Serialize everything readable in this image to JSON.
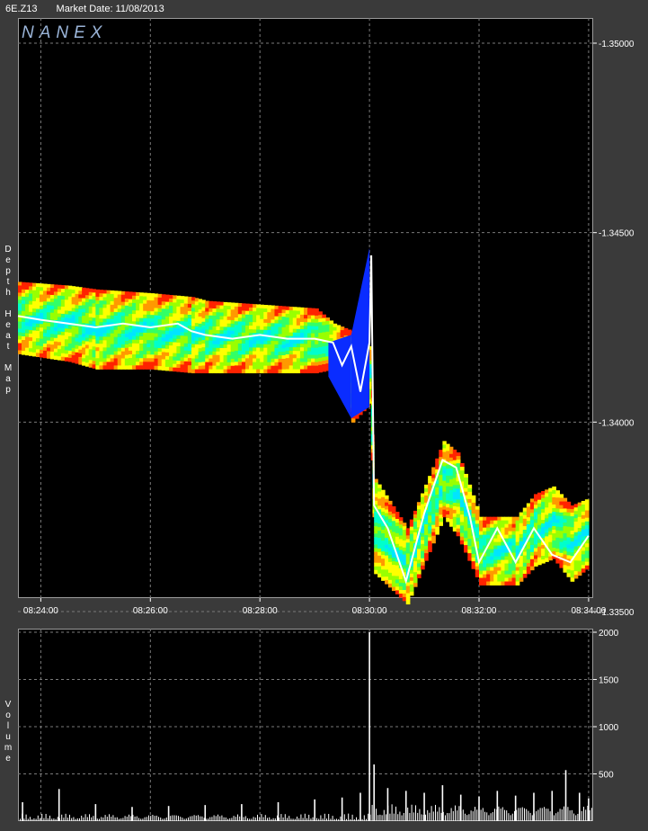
{
  "header": {
    "symbol": "6E.Z13",
    "market_date": "Market Date: 11/08/2013"
  },
  "logo": "NANEX",
  "colors": {
    "background": "#000000",
    "frame": "#3a3a3a",
    "grid": "#7a7a7a",
    "price_line": "#ffffff",
    "volume": "#ffffff"
  },
  "chart_data": [
    {
      "type": "heatmap",
      "title": "",
      "ylabel": "Depth Heat Map",
      "x_ticks": [
        "08:24:00",
        "08:26:00",
        "08:28:00",
        "08:30:00",
        "08:32:00",
        "08:34:00"
      ],
      "y_ticks": [
        "-1.35000",
        "-1.34500",
        "-1.34000",
        "-1.33500"
      ],
      "xlim": [
        "08:23:35",
        "08:34:05"
      ],
      "ylim": [
        1.335,
        1.35
      ],
      "grid": true,
      "price_series": {
        "name": "",
        "x": [
          "08:23:35",
          "08:24:00",
          "08:24:30",
          "08:25:00",
          "08:25:30",
          "08:26:00",
          "08:26:30",
          "08:26:45",
          "08:27:00",
          "08:27:30",
          "08:28:00",
          "08:28:30",
          "08:29:00",
          "08:29:20",
          "08:29:30",
          "08:29:40",
          "08:29:50",
          "08:30:00",
          "08:30:02",
          "08:30:05",
          "08:30:20",
          "08:30:40",
          "08:31:00",
          "08:31:20",
          "08:31:35",
          "08:31:50",
          "08:32:00",
          "08:32:20",
          "08:32:40",
          "08:33:00",
          "08:33:20",
          "08:33:40",
          "08:34:00"
        ],
        "y": [
          1.3428,
          1.3427,
          1.3426,
          1.3425,
          1.3426,
          1.3425,
          1.3426,
          1.3424,
          1.3423,
          1.3422,
          1.3423,
          1.3422,
          1.3422,
          1.3421,
          1.3415,
          1.342,
          1.3408,
          1.3421,
          1.3444,
          1.3378,
          1.3372,
          1.3358,
          1.3376,
          1.339,
          1.3388,
          1.3375,
          1.3363,
          1.3372,
          1.3363,
          1.3372,
          1.3365,
          1.3363,
          1.337
        ]
      },
      "depth_band": {
        "x": [
          "08:23:35",
          "08:24:30",
          "08:25:00",
          "08:26:00",
          "08:26:45",
          "08:27:00",
          "08:28:00",
          "08:29:00",
          "08:29:20",
          "08:29:40",
          "08:30:00",
          "08:30:05",
          "08:30:40",
          "08:31:20",
          "08:31:35",
          "08:32:00",
          "08:32:40",
          "08:33:00",
          "08:33:20",
          "08:33:40",
          "08:34:00"
        ],
        "top": [
          1.3437,
          1.3436,
          1.3435,
          1.3434,
          1.3433,
          1.3432,
          1.3431,
          1.343,
          1.3426,
          1.3424,
          1.342,
          1.3385,
          1.3372,
          1.3395,
          1.3392,
          1.3375,
          1.3375,
          1.3381,
          1.3383,
          1.3378,
          1.338
        ],
        "bottom": [
          1.3418,
          1.3416,
          1.3414,
          1.3414,
          1.3413,
          1.3413,
          1.3413,
          1.3413,
          1.3414,
          1.34,
          1.3405,
          1.336,
          1.3352,
          1.3375,
          1.337,
          1.3357,
          1.3357,
          1.3362,
          1.3364,
          1.3358,
          1.3362
        ]
      }
    },
    {
      "type": "bar",
      "title": "",
      "ylabel": "Volume",
      "y_ticks": [
        "2000",
        "1500",
        "1000",
        "500"
      ],
      "ylim": [
        0,
        2000
      ],
      "grid": true,
      "series": [
        {
          "name": "",
          "x": [
            "08:23:40",
            "08:24:20",
            "08:25:00",
            "08:25:40",
            "08:26:20",
            "08:27:00",
            "08:27:40",
            "08:28:20",
            "08:29:00",
            "08:29:30",
            "08:29:50",
            "08:30:00",
            "08:30:05",
            "08:30:20",
            "08:30:40",
            "08:31:00",
            "08:31:20",
            "08:31:40",
            "08:32:00",
            "08:32:20",
            "08:32:40",
            "08:33:00",
            "08:33:20",
            "08:33:35",
            "08:33:50",
            "08:34:00"
          ],
          "values": [
            200,
            340,
            180,
            150,
            160,
            170,
            180,
            200,
            230,
            250,
            300,
            2000,
            600,
            350,
            320,
            300,
            380,
            280,
            260,
            320,
            270,
            300,
            320,
            540,
            300,
            240
          ]
        }
      ]
    }
  ],
  "ylabels": {
    "main": "Depth Heat Map",
    "volume": "Volume"
  }
}
